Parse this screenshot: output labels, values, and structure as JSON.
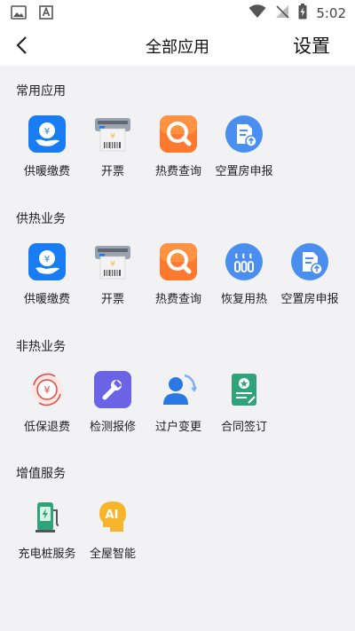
{
  "status_bar": {
    "time": "5:02",
    "icons": [
      "image-icon",
      "a-icon",
      "wifi-icon",
      "no-signal-icon",
      "battery-charging-icon"
    ]
  },
  "header": {
    "title": "全部应用",
    "settings_label": "设置"
  },
  "sections": [
    {
      "title": "常用应用",
      "items": [
        {
          "label": "供暖缴费",
          "icon": "heating-payment-icon"
        },
        {
          "label": "开票",
          "icon": "invoice-icon"
        },
        {
          "label": "热费查询",
          "icon": "search-fee-icon"
        },
        {
          "label": "空置房申报",
          "icon": "vacant-room-report-icon"
        }
      ]
    },
    {
      "title": "供热业务",
      "items": [
        {
          "label": "供暖缴费",
          "icon": "heating-payment-icon"
        },
        {
          "label": "开票",
          "icon": "invoice-icon"
        },
        {
          "label": "热费查询",
          "icon": "search-fee-icon"
        },
        {
          "label": "恢复用热",
          "icon": "restore-heating-icon"
        },
        {
          "label": "空置房申报",
          "icon": "vacant-room-report-icon"
        }
      ]
    },
    {
      "title": "非热业务",
      "items": [
        {
          "label": "低保退费",
          "icon": "refund-icon"
        },
        {
          "label": "检测报修",
          "icon": "repair-wrench-icon"
        },
        {
          "label": "过户变更",
          "icon": "transfer-user-icon"
        },
        {
          "label": "合同签订",
          "icon": "contract-sign-icon"
        }
      ]
    },
    {
      "title": "增值服务",
      "items": [
        {
          "label": "充电桩服务",
          "icon": "charging-pile-icon"
        },
        {
          "label": "全屋智能",
          "icon": "smart-home-ai-icon"
        }
      ]
    }
  ],
  "colors": {
    "primary_blue": "#1a7cf2",
    "accent_orange": "#ff6a2a",
    "accent_yellow": "#f7b52c",
    "purple": "#6b63e6",
    "red": "#e8453c",
    "green": "#2fa37a"
  }
}
